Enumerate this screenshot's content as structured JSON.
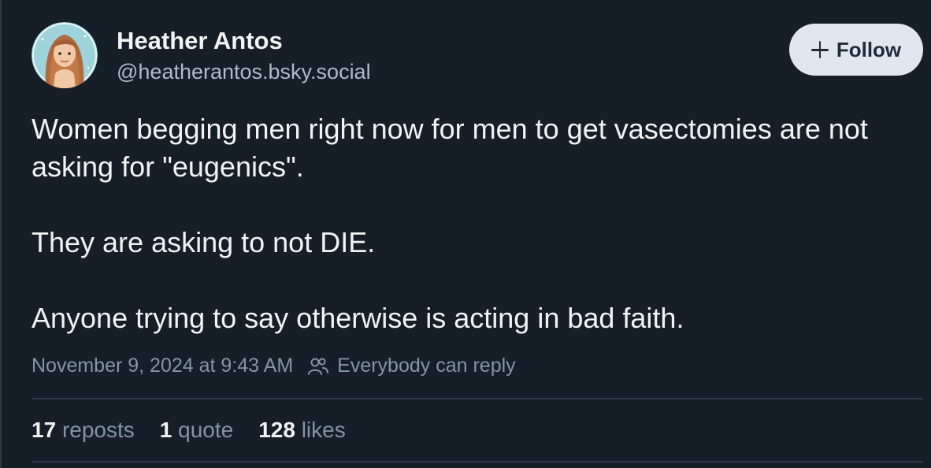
{
  "author": {
    "display_name": "Heather Antos",
    "handle": "@heatherantos.bsky.social",
    "avatar_icon": "avatar-illustration"
  },
  "follow_button": {
    "label": "Follow",
    "icon": "plus-icon"
  },
  "post": {
    "paragraphs": [
      "Women begging men right now for men to get vasectomies are not asking for \"eugenics\".",
      "They are asking to not DIE.",
      "Anyone trying to say otherwise is acting in bad faith."
    ]
  },
  "meta": {
    "timestamp": "November 9, 2024 at 9:43 AM",
    "reply_icon": "people-icon",
    "reply_setting": "Everybody can reply"
  },
  "stats": {
    "reposts_count": "17",
    "reposts_label": "reposts",
    "quotes_count": "1",
    "quotes_label": "quote",
    "likes_count": "128",
    "likes_label": "likes"
  },
  "colors": {
    "background": "#161e27",
    "text_primary": "#f1f3f5",
    "text_secondary": "#8495a6",
    "follow_bg": "#e0e7ef"
  }
}
